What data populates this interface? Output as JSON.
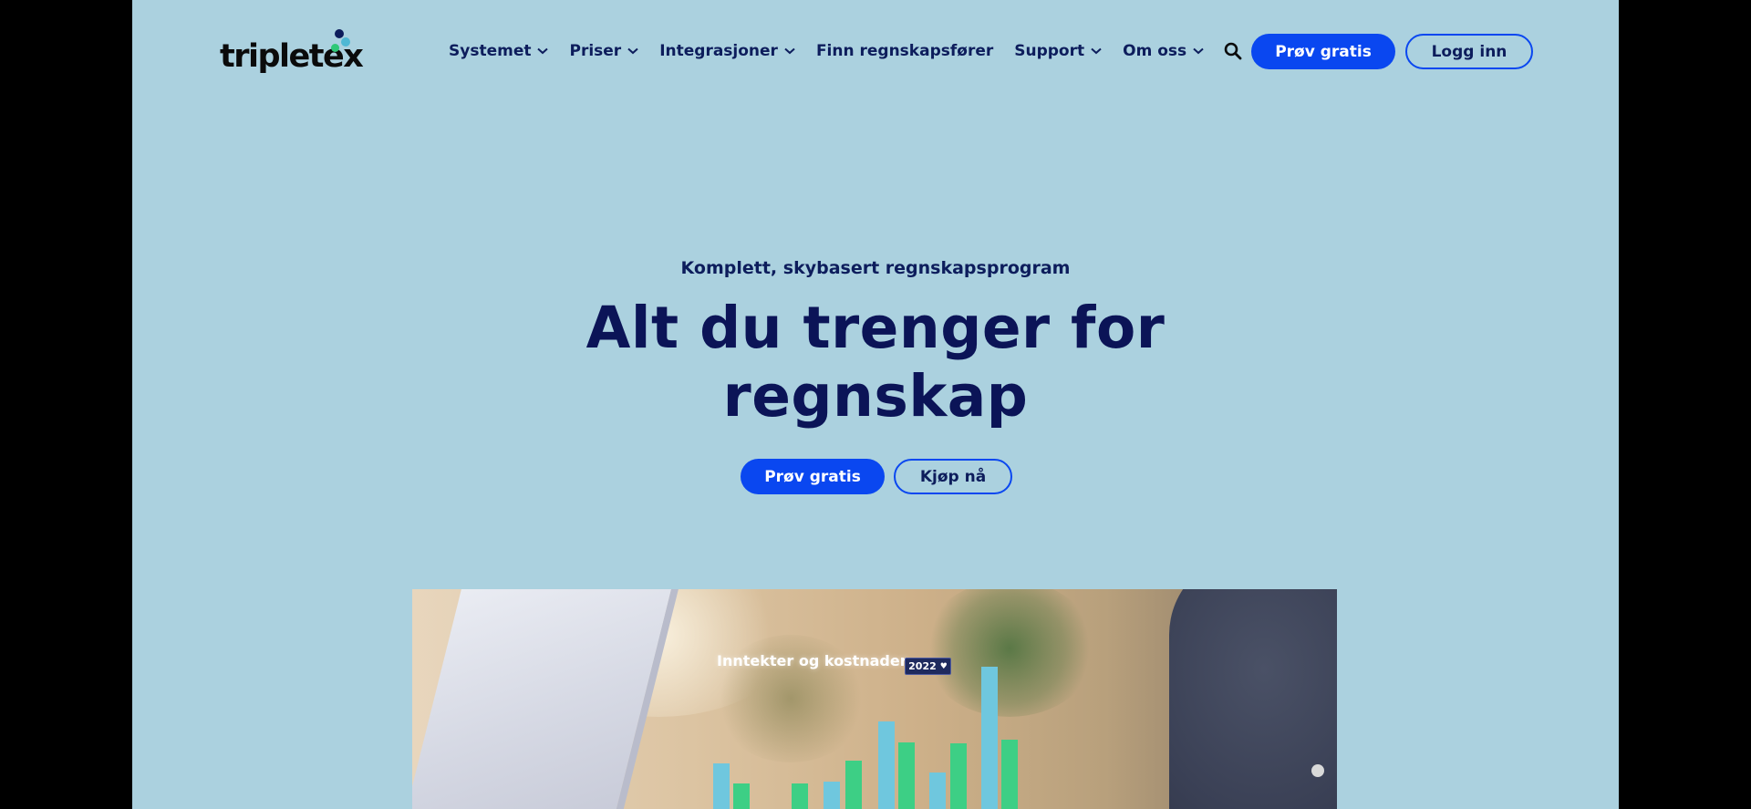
{
  "brand": {
    "logo_text": "tripletex",
    "dot_colors": [
      "#0d1d5c",
      "#4fb8d4",
      "#2fc877"
    ]
  },
  "nav": {
    "items": [
      {
        "label": "Systemet",
        "dropdown": true
      },
      {
        "label": "Priser",
        "dropdown": true
      },
      {
        "label": "Integrasjoner",
        "dropdown": true
      },
      {
        "label": "Finn regnskapsfører",
        "dropdown": false
      },
      {
        "label": "Support",
        "dropdown": true
      },
      {
        "label": "Om oss",
        "dropdown": true
      }
    ],
    "search_icon": "search-icon",
    "try_free_label": "Prøv gratis",
    "login_label": "Logg inn"
  },
  "hero": {
    "eyebrow": "Komplett, skybasert regnskapsprogram",
    "headline_line1": "Alt du trenger for",
    "headline_line2": "regnskap",
    "cta_primary": "Prøv gratis",
    "cta_secondary": "Kjøp nå"
  },
  "hero_image": {
    "widget_title": "Inntekter og kostnader",
    "year_value": "2022",
    "bar_colors": {
      "income": "#6fc7de",
      "cost": "#3dcf85"
    }
  },
  "colors": {
    "background": "#abd1df",
    "accent": "#0a47f0",
    "text_dark": "#0d1d5c"
  }
}
